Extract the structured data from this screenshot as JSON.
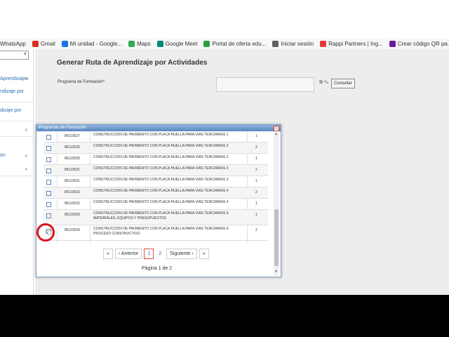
{
  "bookmarks": [
    {
      "label": "WhatsApp",
      "color": "#25d366"
    },
    {
      "label": "Gmail",
      "color": "#d93025"
    },
    {
      "label": "Mi unidad - Google...",
      "color": "#1a73e8"
    },
    {
      "label": "Maps",
      "color": "#34a853"
    },
    {
      "label": "Google Meet",
      "color": "#00897b"
    },
    {
      "label": "Portal de oferta edu...",
      "color": "#2e9e3e"
    },
    {
      "label": "Iniciar sesión",
      "color": "#5f6368"
    },
    {
      "label": "Rappi Partners | Ing...",
      "color": "#e53935"
    },
    {
      "label": "Crear código QR pa...",
      "color": "#6a1b9a"
    }
  ],
  "sidebar": {
    "items": [
      {
        "label": "Aprendizaje",
        "arrow": "˅"
      },
      {
        "label": "ndizaje por",
        "arrow": ""
      },
      {
        "label": "dizaje por",
        "arrow": ""
      },
      {
        "label": "",
        "arrow": "‹"
      },
      {
        "label": "ón",
        "arrow": "‹"
      },
      {
        "label": "",
        "arrow": "‹"
      }
    ],
    "select_chevron": "˅"
  },
  "page": {
    "title": "Generar Ruta de Aprendizaje por Actividades",
    "form_label": "Programa de Formación*",
    "form_value": "",
    "consultar_label": "Consultar",
    "icons": "⧉ ✎"
  },
  "modal": {
    "title": "Programas de Formación",
    "close_label": "x",
    "rows": [
      {
        "code": "86110527",
        "name": "CONSTRUCCION DE PAVIMENTO CON PLACA HUELLA PARA VIAS TERCIARIAS 1",
        "num": "1"
      },
      {
        "code": "86110526",
        "name": "CONSTRUCCION DE PAVIMENTO CON PLACA HUELLA PARA VIAS TERCIARIAS 2",
        "num": "2"
      },
      {
        "code": "86110528",
        "name": "CONSTRUCCION DE PAVIMENTO CON PLACA HUELLA PARA VIAS TERCIARIAS 2",
        "num": "1"
      },
      {
        "code": "86110531",
        "name": "CONSTRUCCION DE PAVIMENTO CON PLACA HUELLA PARA VIAS TERCIARIAS 3",
        "num": "2"
      },
      {
        "code": "86110531",
        "name": "CONSTRUCCION DE PAVIMENTO CON PLACA HUELLA PARA VIAS TERCIARIAS 3",
        "num": "1"
      },
      {
        "code": "86110532",
        "name": "CONSTRUCCION DE PAVIMENTO CON PLACA HUELLA PARA VIAS TERCIARIAS 4",
        "num": "2"
      },
      {
        "code": "86110532",
        "name": "CONSTRUCCION DE PAVIMENTO CON PLACA HUELLA PARA VIAS TERCIARIAS 4",
        "num": "1"
      },
      {
        "code": "86110533",
        "name": "CONSTRUCCION DE PAVIMENTO CON PLACA HUELLA PARA VIAS TERCIARIAS 5: MATERIALES, EQUIPOS Y PRESUPUESTOS",
        "num": "1"
      },
      {
        "code": "86110534",
        "name": "CONSTRUCCION DE PAVIMENTO CON PLACA HUELLA PARA VIAS TERCIARIAS 6: PROCESO CONSTRUCTIVO",
        "num": "2"
      }
    ],
    "pager": {
      "first": "«",
      "prev": "‹ Anterior",
      "pages": [
        "1",
        "2"
      ],
      "current": "1",
      "next": "Siguiente ›",
      "last": "»"
    },
    "page_info": "Página 1 de 2",
    "scroll_up": "▲",
    "scroll_down": "▼"
  },
  "colors": {
    "accent": "#2a6fb0",
    "modal_header": "#5a87bd",
    "cursor_ring": "#d9131a"
  }
}
